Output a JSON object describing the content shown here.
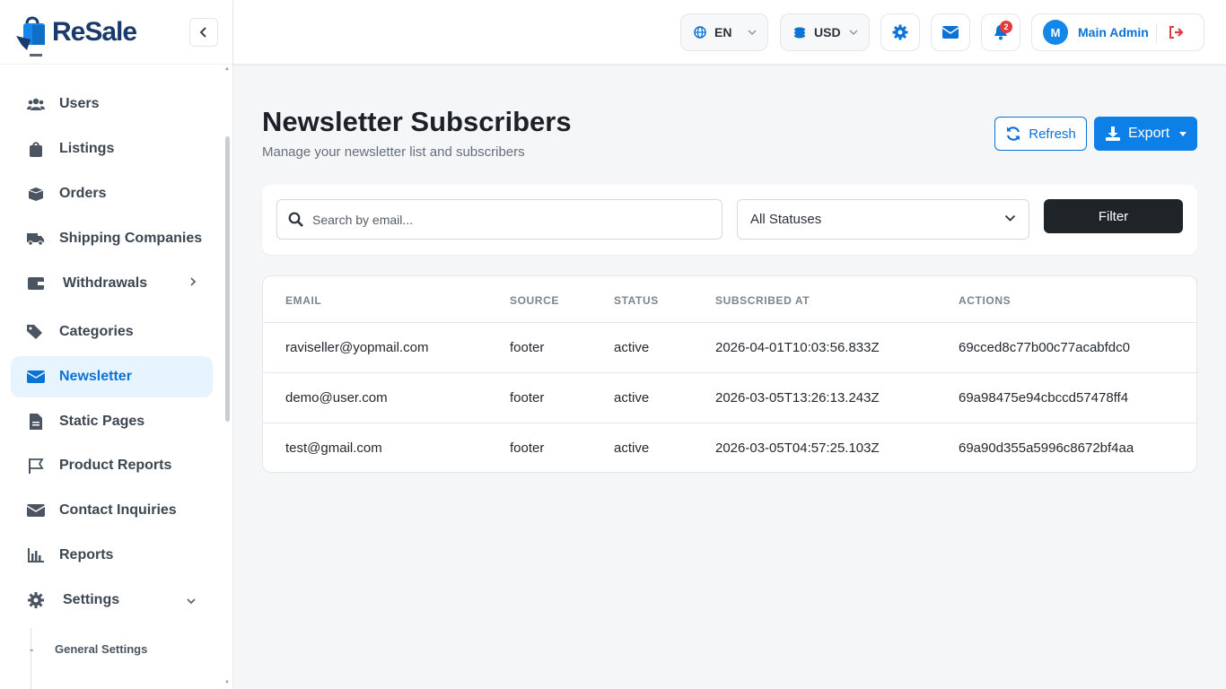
{
  "brand": {
    "name_re": "Re",
    "name_sale": "Sale"
  },
  "sidebar": {
    "items": [
      {
        "label": "Users",
        "icon": "users-icon"
      },
      {
        "label": "Listings",
        "icon": "bag-icon"
      },
      {
        "label": "Orders",
        "icon": "box-icon"
      },
      {
        "label": "Shipping Companies",
        "icon": "truck-icon"
      },
      {
        "label": "Withdrawals",
        "icon": "wallet-icon"
      },
      {
        "label": "Categories",
        "icon": "tags-icon"
      },
      {
        "label": "Newsletter",
        "icon": "envelope-icon",
        "active": true
      },
      {
        "label": "Static Pages",
        "icon": "file-icon"
      },
      {
        "label": "Product Reports",
        "icon": "flag-icon"
      },
      {
        "label": "Contact Inquiries",
        "icon": "envelope-icon"
      },
      {
        "label": "Reports",
        "icon": "chart-icon"
      },
      {
        "label": "Settings",
        "icon": "gear-icon"
      }
    ],
    "sub_items": [
      {
        "label": "General Settings",
        "dash": "-"
      }
    ]
  },
  "topbar": {
    "language": "EN",
    "currency": "USD",
    "notifications_count": "2",
    "user_initial": "M",
    "user_name": "Main Admin"
  },
  "page": {
    "title": "Newsletter Subscribers",
    "subtitle": "Manage your newsletter list and subscribers",
    "refresh_label": "Refresh",
    "export_label": "Export"
  },
  "filters": {
    "search_placeholder": "Search by email...",
    "status_value": "All Statuses",
    "filter_label": "Filter"
  },
  "table": {
    "columns": [
      "EMAIL",
      "SOURCE",
      "STATUS",
      "SUBSCRIBED AT",
      "ACTIONS"
    ],
    "rows": [
      [
        "raviseller@yopmail.com",
        "footer",
        "active",
        "2026-04-01T10:03:56.833Z",
        "69cced8c77b00c77acabfdc0"
      ],
      [
        "demo@user.com",
        "footer",
        "active",
        "2026-03-05T13:26:13.243Z",
        "69a98475e94cbccd57478ff4"
      ],
      [
        "test@gmail.com",
        "footer",
        "active",
        "2026-03-05T04:57:25.103Z",
        "69a90d355a5996c8672bf4aa"
      ]
    ]
  },
  "colors": {
    "accent": "#0d80e8",
    "brand_dark": "#1a3a6b",
    "badge": "#e23b3b"
  }
}
